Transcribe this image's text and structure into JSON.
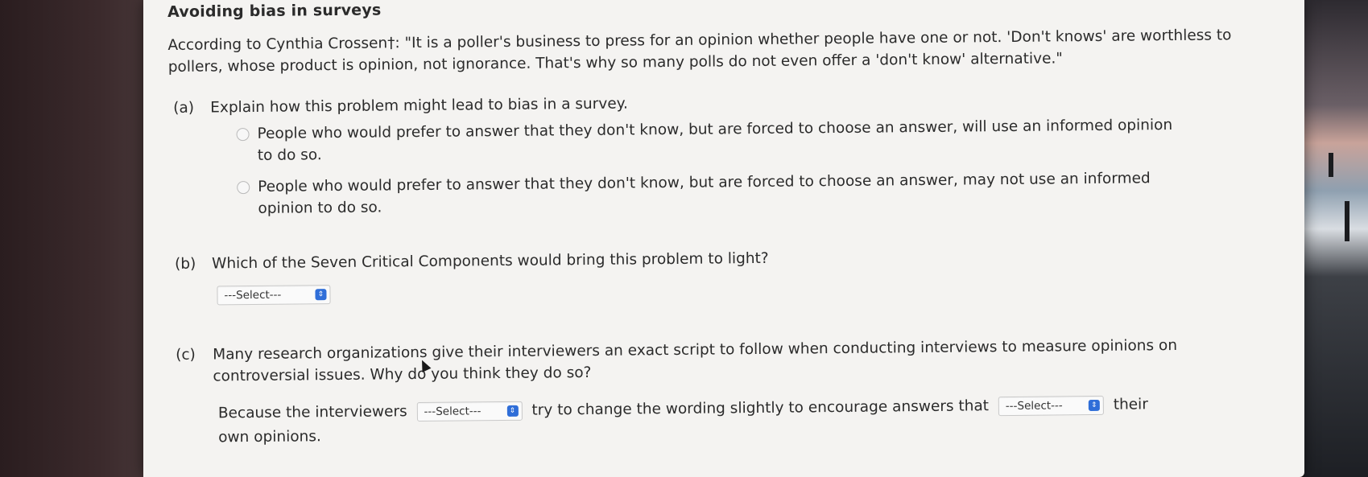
{
  "title": "Avoiding bias in surveys",
  "intro": "According to Cynthia Crossen†: \"It is a poller's business to press for an opinion whether people have one or not. 'Don't knows' are worthless to pollers, whose product is opinion, not ignorance. That's why so many polls do not even offer a 'don't know' alternative.\"",
  "part_a": {
    "label": "(a)",
    "question": "Explain how this problem might lead to bias in a survey.",
    "options": [
      "People who would prefer to answer that they don't know, but are forced to choose an answer, will use an informed opinion to do so.",
      "People who would prefer to answer that they don't know, but are forced to choose an answer, may not use an informed opinion to do so."
    ]
  },
  "part_b": {
    "label": "(b)",
    "question": "Which of the Seven Critical Components would bring this problem to light?",
    "select_value": "---Select---"
  },
  "part_c": {
    "label": "(c)",
    "question": "Many research organizations give their interviewers an exact script to follow when conducting interviews to measure opinions on controversial issues. Why do you think they do so?",
    "sentence_start": "Because the interviewers",
    "select1_value": "---Select---",
    "sentence_middle": "try to change the wording slightly to encourage answers that",
    "select2_value": "---Select---",
    "sentence_end": "their own opinions."
  },
  "icons": {
    "select_chevron": "⇕"
  }
}
